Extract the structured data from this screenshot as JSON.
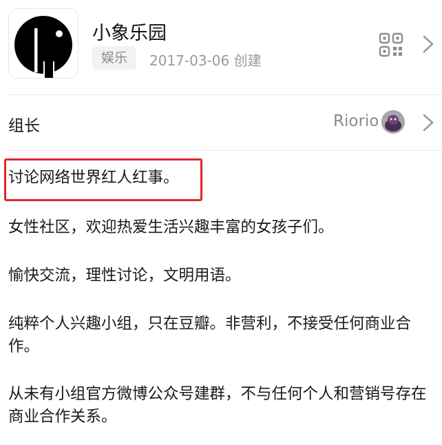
{
  "group": {
    "name": "小象乐园",
    "category": "娱乐",
    "created": "2017-03-06 创建"
  },
  "owner": {
    "label": "组长",
    "name": "Riorio"
  },
  "description": [
    "讨论网络世界红人红事。",
    "女性社区，欢迎热爱生活兴趣丰富的女孩子们。",
    "愉快交流，理性讨论，文明用语。",
    "纯粹个人兴趣小组，只在豆瓣。非营利，不接受任何商业合作。",
    "从未有小组官方微博公众号建群，不与任何个人和营销号存在商业合作关系。"
  ],
  "icons": {
    "logo": "elephant-logo-icon",
    "qr": "qr-code-icon",
    "chevron": "chevron-right-icon",
    "avatar": "owner-avatar"
  },
  "colors": {
    "highlight": "#e0262b",
    "muted_text": "#8a8a8a",
    "tag_bg": "#f2f2f2"
  }
}
